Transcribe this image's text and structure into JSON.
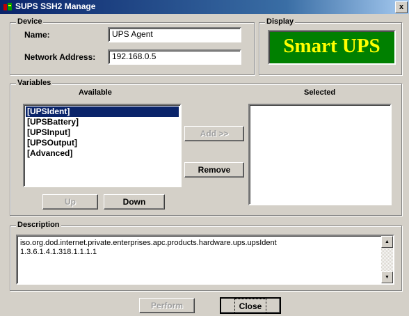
{
  "window": {
    "title": "SUPS SSH2 Manage",
    "icon": "app-icon",
    "close_glyph": "x"
  },
  "device": {
    "group_label": "Device",
    "name_label": "Name:",
    "name_value": "UPS Agent",
    "address_label": "Network Address:",
    "address_value": "192.168.0.5"
  },
  "display": {
    "group_label": "Display",
    "text": "Smart UPS",
    "bg_color": "#008000",
    "text_color": "#ffff00"
  },
  "variables": {
    "group_label": "Variables",
    "available_label": "Available",
    "selected_label": "Selected",
    "available_items": [
      "[UPSIdent]",
      "[UPSBattery]",
      "[UPSInput]",
      "[UPSOutput]",
      "[Advanced]"
    ],
    "selected_index": 0,
    "add_label": "Add >>",
    "remove_label": "Remove",
    "up_label": "Up",
    "down_label": "Down"
  },
  "description": {
    "group_label": "Description",
    "line1": "iso.org.dod.internet.private.enterprises.apc.products.hardware.ups.upsIdent",
    "line2": "1.3.6.1.4.1.318.1.1.1.1"
  },
  "footer": {
    "perform_label": "Perform",
    "close_label": "Close"
  }
}
